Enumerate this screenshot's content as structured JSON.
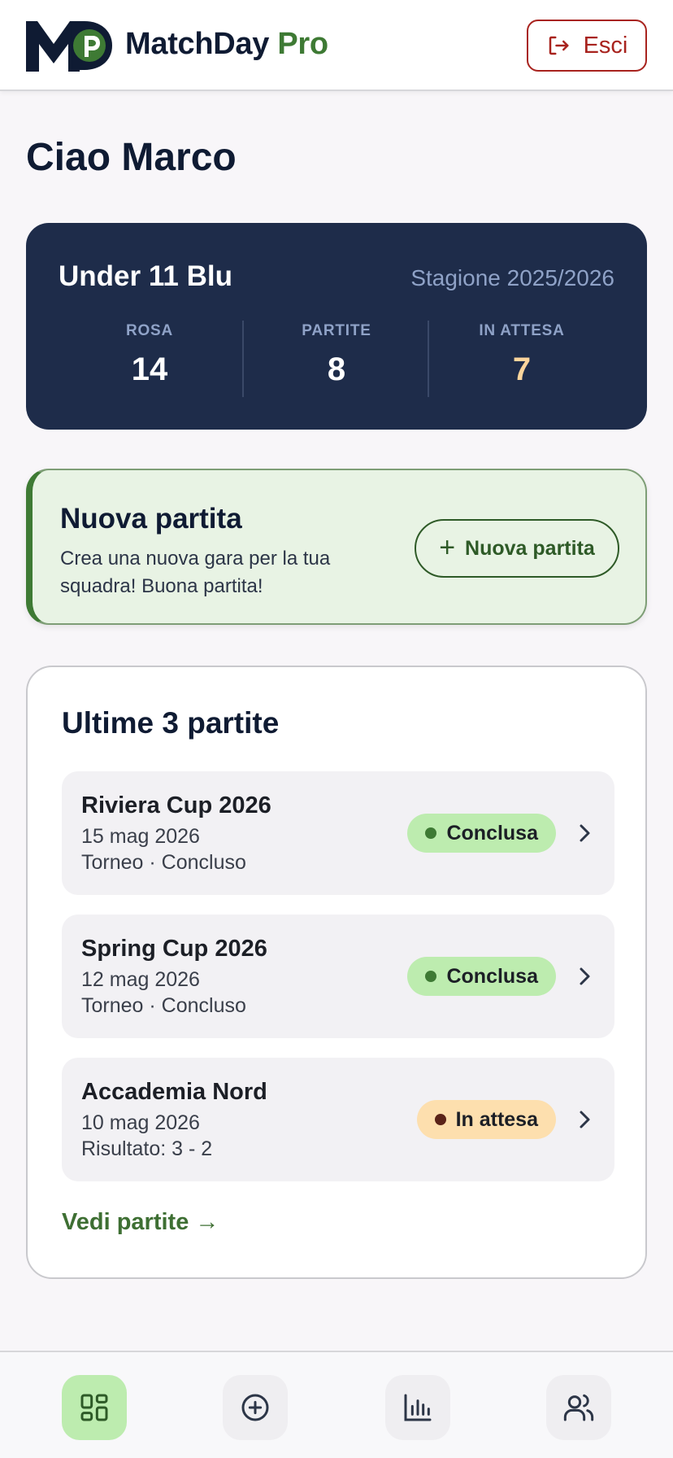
{
  "app": {
    "brand_part1": "MatchDay",
    "brand_part2": "Pro",
    "logout_label": "Esci",
    "colors": {
      "navy": "#1e2c4a",
      "brand_green": "#3e7a34",
      "danger": "#a8231e",
      "pending": "#fcd59c"
    }
  },
  "greeting": "Ciao Marco",
  "team": {
    "name": "Under 11 Blu",
    "season": "Stagione 2025/2026",
    "stats": [
      {
        "label": "ROSA",
        "value": "14"
      },
      {
        "label": "PARTITE",
        "value": "8"
      },
      {
        "label": "IN ATTESA",
        "value": "7"
      }
    ]
  },
  "new_match": {
    "title": "Nuova partita",
    "description": "Crea una nuova gara per la tua squadra! Buona partita!",
    "button_label": "Nuova partita"
  },
  "recent": {
    "title": "Ultime 3 partite",
    "matches": [
      {
        "name": "Riviera Cup 2026",
        "date": "15 mag 2026",
        "meta": "Torneo · Concluso",
        "status": "Conclusa"
      },
      {
        "name": "Spring Cup 2026",
        "date": "12 mag 2026",
        "meta": "Torneo · Concluso",
        "status": "Conclusa"
      },
      {
        "name": "Accademia Nord",
        "date": "10 mag 2026",
        "meta": "Risultato: 3 - 2",
        "status": "In attesa"
      }
    ],
    "see_all": "Vedi partite →"
  },
  "nav": {
    "items": [
      {
        "icon": "dashboard-icon",
        "active": true
      },
      {
        "icon": "add-circle-icon",
        "active": false
      },
      {
        "icon": "bar-chart-icon",
        "active": false
      },
      {
        "icon": "users-icon",
        "active": false
      }
    ]
  }
}
